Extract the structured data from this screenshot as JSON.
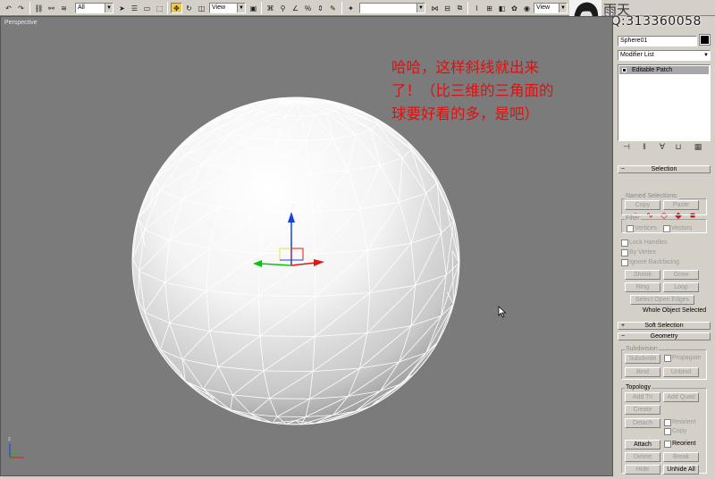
{
  "toolbar": {
    "selection_filter": "All",
    "ref_coord": "View",
    "named_selection": "",
    "ref_coord_2": "View"
  },
  "watermark": {
    "name": "雨天",
    "qq": "QQ:313360058"
  },
  "viewport": {
    "label": "Perspective",
    "note_lines": [
      "哈哈，这样斜线就出来",
      "了！（比三维的三角面的",
      "球要好看的多，是吧）"
    ],
    "gizmo_axis_label": "z",
    "world_axis_label": "z"
  },
  "panel": {
    "object_name": "Sphere01",
    "modifier_list": "Modifier List",
    "stack_item": "Editable Patch",
    "selection": {
      "title": "Selection",
      "named_selections_label": "Named Selections:",
      "copy": "Copy",
      "paste": "Paste",
      "filter_label": "Filter",
      "vertices": "Vertices",
      "vectors": "Vectors",
      "lock_handles": "Lock Handles",
      "by_vertex": "By Vertex",
      "ignore_backfacing": "Ignore Backfacing",
      "shrink": "Shrink",
      "grow": "Grow",
      "ring": "Ring",
      "loop": "Loop",
      "select_open_edges": "Select Open Edges",
      "status": "Whole Object Selected"
    },
    "soft_selection": {
      "title": "Soft Selection"
    },
    "geometry": {
      "title": "Geometry",
      "subdivision_label": "Subdivision",
      "subdivide": "Subdivide",
      "propagate": "Propagate",
      "bind": "Bind",
      "unbind": "Unbind",
      "topology_label": "Topology",
      "add_tri": "Add Tri",
      "add_quad": "Add Quad",
      "create": "Create",
      "detach": "Detach",
      "reorient_1": "Reorient",
      "copy": "Copy",
      "attach": "Attach",
      "reorient_2": "Reorient",
      "delete": "Delete",
      "break": "Break",
      "hide": "Hide",
      "unhide_all": "Unhide All"
    }
  },
  "colors": {
    "viewport_bg": "#7b7b7b",
    "wire": "#ffffff",
    "note": "#e01010",
    "axis_x": "#e01818",
    "axis_y": "#10c010",
    "axis_z": "#1840e0"
  }
}
